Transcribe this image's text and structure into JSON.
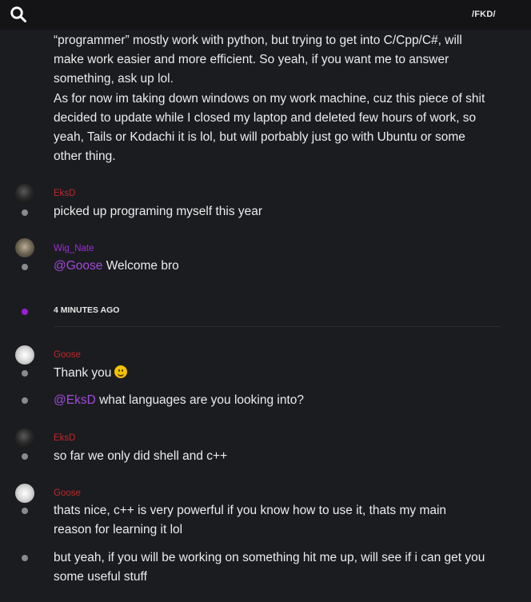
{
  "header": {
    "search_icon": "search-icon",
    "channel_name": "/FKD/"
  },
  "messages": {
    "intro_lines": [
      "“programmer” mostly work with python, but trying to get into C/Cpp/C#, will",
      "make work easier and more efficient. So yeah, if you want me to answer",
      "something, ask up lol.",
      "As for now im taking down windows on my work machine, cuz this piece of shit",
      "decided to update while I closed my laptop and deleted few hours of work, so",
      "yeah, Tails or Kodachi it is lol, but will porbably just go with Ubuntu or some",
      "other thing."
    ],
    "m1": {
      "user": "EksD",
      "text": "picked up programing myself this year"
    },
    "m2": {
      "user": "Wig_Nate",
      "mention": "@Goose",
      "text": " Welcome bro"
    },
    "time_separator": "4 MINUTES AGO",
    "m3": {
      "user": "Goose",
      "text": "Thank you",
      "emoji": "smile-emoji"
    },
    "m4": {
      "mention": "@EksD",
      "text": " what languages are you looking into?"
    },
    "m5": {
      "user": "EksD",
      "text": "so far we only did shell and c++"
    },
    "m6": {
      "user": "Goose",
      "lines": [
        "thats nice, c++ is very powerful if you know how to use it, thats my main",
        "reason for learning it lol"
      ]
    },
    "m7": {
      "lines": [
        "but yeah, if you will be working on something hit me up, will see if i can get you",
        "some useful stuff"
      ]
    }
  },
  "colors": {
    "background": "#1b1c20",
    "topbar": "#141417",
    "username_red": "#c0282a",
    "username_purple": "#9b2fd0",
    "mention": "#a04ad8",
    "new_marker": "#9b1ed8"
  }
}
